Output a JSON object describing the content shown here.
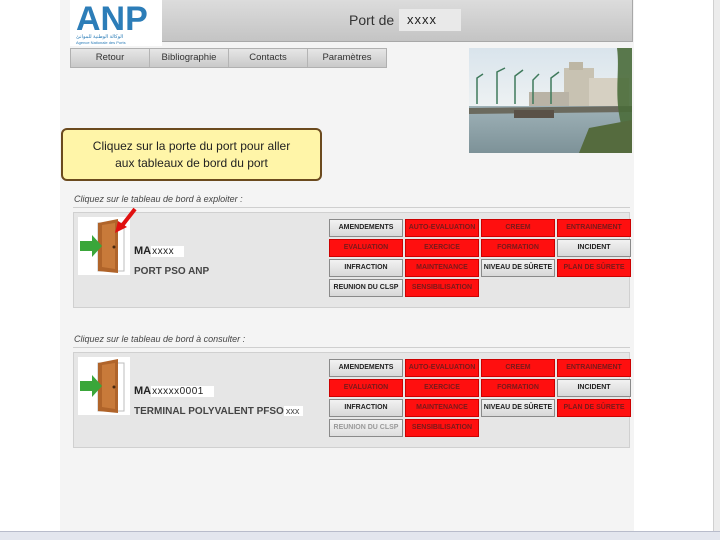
{
  "header": {
    "title": "Port de",
    "port_name": "xxxx",
    "logo_text": "ANP",
    "logo_sub_arabic": "الوكالة الوطنية للموانئ",
    "logo_sub_fr": "Agence Nationale des Ports"
  },
  "nav": {
    "items": [
      "Retour",
      "Bibliographie",
      "Contacts",
      "Paramètres"
    ]
  },
  "callout": {
    "line1": "Cliquez sur la porte du port pour aller",
    "line2": "aux tableaux de bord du port"
  },
  "sections": [
    {
      "label": "Cliquez sur le tableau de bord à exploiter :",
      "code_prefix": "MA",
      "code_value": "xxxx",
      "name": "PORT PSO ANP",
      "name_suffix": "",
      "buttons": [
        {
          "label": "AMENDEMENTS",
          "style": "grey"
        },
        {
          "label": "AUTO-EVALUATION",
          "style": "red"
        },
        {
          "label": "CREEM",
          "style": "red"
        },
        {
          "label": "ENTRAINEMENT",
          "style": "red"
        },
        {
          "label": "EVALUATION",
          "style": "red"
        },
        {
          "label": "EXERCICE",
          "style": "red"
        },
        {
          "label": "FORMATION",
          "style": "red"
        },
        {
          "label": "INCIDENT",
          "style": "grey"
        },
        {
          "label": "INFRACTION",
          "style": "grey"
        },
        {
          "label": "MAINTENANCE",
          "style": "red"
        },
        {
          "label": "NIVEAU DE SÛRETE",
          "style": "grey"
        },
        {
          "label": "PLAN DE SÛRETE",
          "style": "red"
        },
        {
          "label": "REUNION DU CLSP",
          "style": "grey"
        },
        {
          "label": "SENSIBILISATION",
          "style": "red"
        }
      ]
    },
    {
      "label": "Cliquez sur le tableau de bord à consulter :",
      "code_prefix": "MA",
      "code_value": "xxxxx0001",
      "name": "TERMINAL POLYVALENT PFSO",
      "name_suffix": "xxx",
      "buttons": [
        {
          "label": "AMENDEMENTS",
          "style": "grey"
        },
        {
          "label": "AUTO-EVALUATION",
          "style": "red"
        },
        {
          "label": "CREEM",
          "style": "red"
        },
        {
          "label": "ENTRAINEMENT",
          "style": "red"
        },
        {
          "label": "EVALUATION",
          "style": "red"
        },
        {
          "label": "EXERCICE",
          "style": "red"
        },
        {
          "label": "FORMATION",
          "style": "red"
        },
        {
          "label": "INCIDENT",
          "style": "grey"
        },
        {
          "label": "INFRACTION",
          "style": "grey"
        },
        {
          "label": "MAINTENANCE",
          "style": "red"
        },
        {
          "label": "NIVEAU DE SÛRETE",
          "style": "grey"
        },
        {
          "label": "PLAN DE SÛRETE",
          "style": "red"
        },
        {
          "label": "REUNION DU CLSP",
          "style": "muted"
        },
        {
          "label": "SENSIBILISATION",
          "style": "red"
        }
      ]
    }
  ],
  "colors": {
    "accent_red": "#ff0f0f",
    "logo_blue": "#2c7db8",
    "callout_bg": "#fff5a8"
  }
}
